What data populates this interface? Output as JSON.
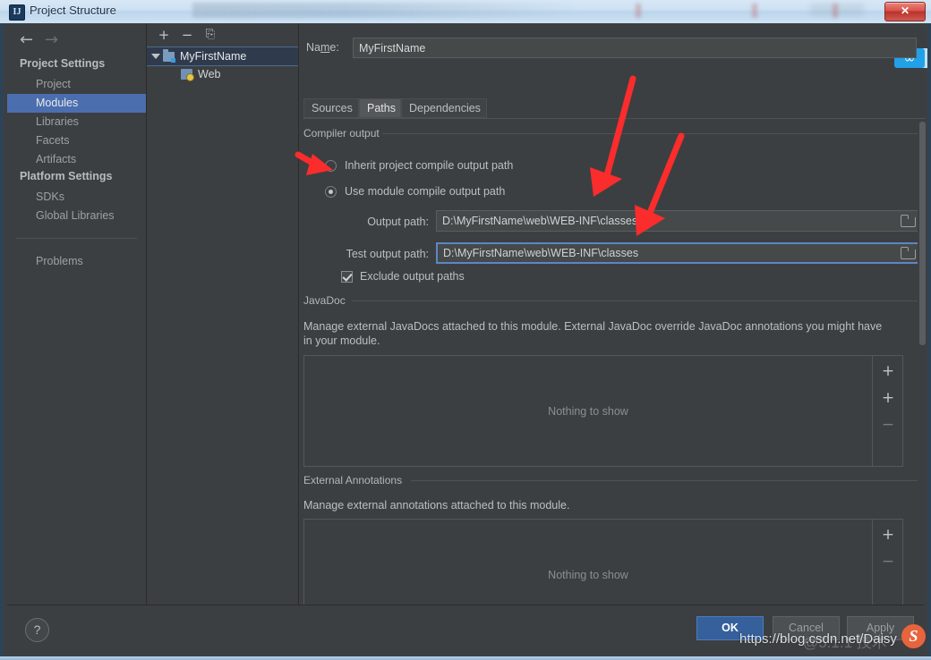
{
  "window": {
    "title": "Project Structure",
    "app_icon": "IJ",
    "close_label": "✕"
  },
  "sidebar": {
    "nav": {
      "back_icon": "←",
      "forward_icon": "→"
    },
    "groups": [
      {
        "heading": "Project Settings",
        "items": [
          {
            "label": "Project",
            "selected": false
          },
          {
            "label": "Modules",
            "selected": true
          },
          {
            "label": "Libraries",
            "selected": false
          },
          {
            "label": "Facets",
            "selected": false
          },
          {
            "label": "Artifacts",
            "selected": false
          }
        ]
      },
      {
        "heading": "Platform Settings",
        "items": [
          {
            "label": "SDKs",
            "selected": false
          },
          {
            "label": "Global Libraries",
            "selected": false
          }
        ]
      }
    ],
    "problems": {
      "label": "Problems"
    }
  },
  "tree": {
    "toolbar": {
      "add": "+",
      "remove": "−",
      "copy": "⎘"
    },
    "nodes": [
      {
        "label": "MyFirstName",
        "selected": true,
        "expanded": true,
        "icon": "module-folder-icon",
        "indent": 0
      },
      {
        "label": "Web",
        "selected": false,
        "expanded": false,
        "icon": "web-facet-icon",
        "indent": 1
      }
    ]
  },
  "main": {
    "name": {
      "label": "Name:",
      "value": "MyFirstName"
    },
    "tabs": [
      {
        "label": "Sources",
        "selected": false
      },
      {
        "label": "Paths",
        "selected": true
      },
      {
        "label": "Dependencies",
        "selected": false
      }
    ],
    "compiler_output": {
      "legend": "Compiler output",
      "radio_inherit": {
        "label": "Inherit project compile output path",
        "selected": false
      },
      "radio_module": {
        "label": "Use module compile output path",
        "selected": true
      },
      "output_path": {
        "label": "Output path:",
        "value": "D:\\MyFirstName\\web\\WEB-INF\\classes",
        "focused": false
      },
      "test_output_path": {
        "label": "Test output path:",
        "value": "D:\\MyFirstName\\web\\WEB-INF\\classes",
        "focused": true
      },
      "exclude": {
        "label": "Exclude output paths",
        "checked": true
      }
    },
    "javadoc": {
      "legend": "JavaDoc",
      "description": "Manage external JavaDocs attached to this module. External JavaDoc override JavaDoc annotations you might have in your module.",
      "empty_text": "Nothing to show",
      "buttons": [
        {
          "name": "add",
          "glyph": "+",
          "enabled": true
        },
        {
          "name": "add-from-url",
          "glyph": "+",
          "enabled": true
        },
        {
          "name": "remove",
          "glyph": "−",
          "enabled": false
        }
      ]
    },
    "external_annotations": {
      "legend": "External Annotations",
      "description": "Manage external annotations attached to this module.",
      "empty_text": "Nothing to show",
      "buttons": [
        {
          "name": "add",
          "glyph": "+",
          "enabled": true
        },
        {
          "name": "remove",
          "glyph": "−",
          "enabled": false
        }
      ]
    },
    "cloud_badge": "∞"
  },
  "footer": {
    "help": "?",
    "ok": "OK",
    "cancel": "Cancel",
    "apply": "Apply"
  },
  "watermark": {
    "url": "https://blog.csdn.net/Daisy",
    "ghost": "@5.1.1  技术"
  },
  "colors": {
    "background": "#3c3f41",
    "selection": "#4b6eaf",
    "accent_primary": "#36609c",
    "focus_border": "#5b87c4",
    "annotation_arrow": "#fb2c2c",
    "badge": "#22a0e8"
  }
}
